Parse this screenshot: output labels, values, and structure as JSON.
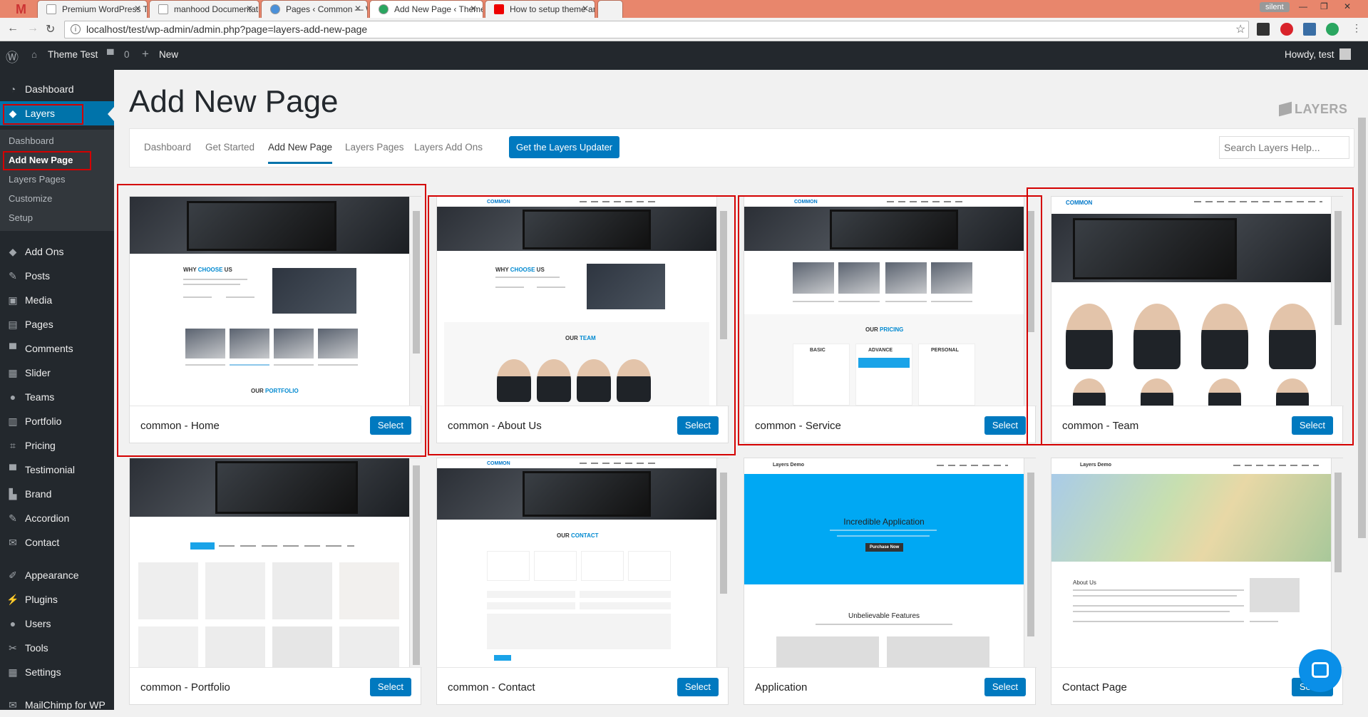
{
  "browser": {
    "tabs": [
      {
        "label": "Premium WordPress The",
        "active": false
      },
      {
        "label": "manhood Documentatio",
        "active": false
      },
      {
        "label": "Pages ‹ Common — Wo",
        "active": false
      },
      {
        "label": "Add New Page ‹ Theme T",
        "active": true
      },
      {
        "label": "How to setup theme and",
        "active": false
      }
    ],
    "profile_label": "silent",
    "url": "localhost/test/wp-admin/admin.php?page=layers-add-new-page"
  },
  "adminbar": {
    "site_name": "Theme Test",
    "comments_count": "0",
    "new_label": "New",
    "howdy": "Howdy, test"
  },
  "sidebar": {
    "top_items": [
      {
        "label": "Dashboard",
        "icon": "dashboard-icon"
      },
      {
        "label": "Layers",
        "icon": "layers-icon",
        "active": true
      }
    ],
    "submenu": [
      {
        "label": "Dashboard"
      },
      {
        "label": "Add New Page",
        "current": true
      },
      {
        "label": "Layers Pages"
      },
      {
        "label": "Customize"
      },
      {
        "label": "Setup"
      }
    ],
    "items": [
      {
        "label": "Add Ons",
        "icon": "addons-icon"
      },
      {
        "label": "Posts",
        "icon": "pin-icon"
      },
      {
        "label": "Media",
        "icon": "media-icon"
      },
      {
        "label": "Pages",
        "icon": "pages-icon"
      },
      {
        "label": "Comments",
        "icon": "comment-icon"
      },
      {
        "label": "Slider",
        "icon": "slider-icon"
      },
      {
        "label": "Teams",
        "icon": "teams-icon"
      },
      {
        "label": "Portfolio",
        "icon": "portfolio-icon"
      },
      {
        "label": "Pricing",
        "icon": "tag-icon"
      },
      {
        "label": "Testimonial",
        "icon": "comment-icon"
      },
      {
        "label": "Brand",
        "icon": "brand-icon"
      },
      {
        "label": "Accordion",
        "icon": "pin-icon"
      },
      {
        "label": "Contact",
        "icon": "mail-icon"
      }
    ],
    "items2": [
      {
        "label": "Appearance",
        "icon": "brush-icon"
      },
      {
        "label": "Plugins",
        "icon": "plug-icon"
      },
      {
        "label": "Users",
        "icon": "user-icon"
      },
      {
        "label": "Tools",
        "icon": "wrench-icon"
      },
      {
        "label": "Settings",
        "icon": "settings-icon"
      },
      {
        "label": "MailChimp for WP",
        "icon": "mail-icon"
      }
    ]
  },
  "page": {
    "title": "Add New Page",
    "brand": "LAYERS"
  },
  "subnav": {
    "links": [
      {
        "label": "Dashboard"
      },
      {
        "label": "Get Started"
      },
      {
        "label": "Add New Page",
        "active": true
      },
      {
        "label": "Layers Pages"
      },
      {
        "label": "Layers Add Ons"
      }
    ],
    "updater_button": "Get the Layers Updater",
    "search_placeholder": "Search Layers Help..."
  },
  "templates": [
    {
      "title": "common - Home",
      "select": "Select",
      "preview_text": {
        "heading_a": "WHY",
        "heading_b": "CHOOSE",
        "heading_c": "US",
        "footer_a": "OUR",
        "footer_b": "PORTFOLIO"
      }
    },
    {
      "title": "common - About Us",
      "select": "Select",
      "preview_text": {
        "heading_a": "WHY",
        "heading_b": "CHOOSE",
        "heading_c": "US",
        "footer_a": "OUR",
        "footer_b": "TEAM"
      }
    },
    {
      "title": "common - Service",
      "select": "Select",
      "preview_text": {
        "heading_a": "OUR",
        "heading_b": "PRICING",
        "plans": [
          "BASIC",
          "ADVANCE",
          "PERSONAL"
        ]
      }
    },
    {
      "title": "common - Team",
      "select": "Select"
    },
    {
      "title": "common - Portfolio",
      "select": "Select"
    },
    {
      "title": "common - Contact",
      "select": "Select",
      "preview_text": {
        "heading_a": "OUR",
        "heading_b": "CONTACT"
      }
    },
    {
      "title": "Application",
      "select": "Select",
      "preview_text": {
        "hero": "Incredible Application",
        "button": "Purchase Now",
        "section": "Unbelievable Features"
      }
    },
    {
      "title": "Contact Page",
      "select": "Select",
      "preview_text": {
        "section": "About Us"
      }
    }
  ],
  "colors": {
    "wp_dark": "#23282d",
    "wp_blue": "#0073aa",
    "button_blue": "#0079bf",
    "highlight_red": "#d40000"
  }
}
